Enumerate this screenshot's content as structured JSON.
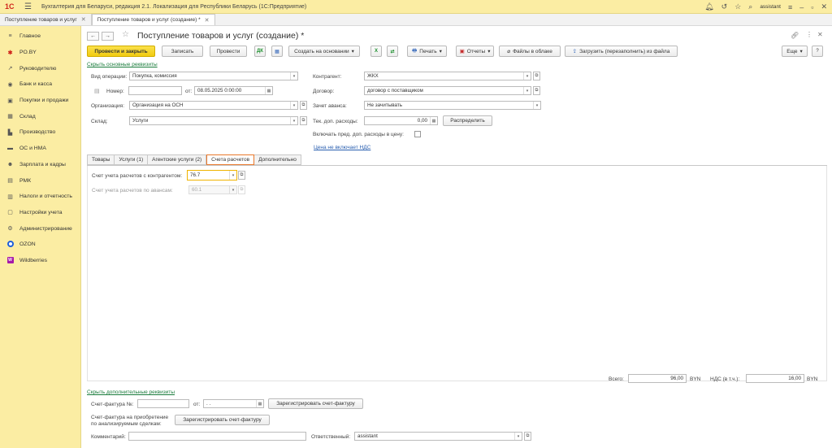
{
  "window": {
    "logo": "1С",
    "title": "Бухгалтерия для Беларуси, редакция 2.1. Локализация для Республики Беларусь   (1С:Предприятие)",
    "user": "assistant"
  },
  "open_tabs": [
    {
      "label": "Поступление товаров и услуг"
    },
    {
      "label": "Поступление товаров и услуг (создание) *"
    }
  ],
  "sidebar": {
    "items": [
      {
        "label": "Главное",
        "icon": "≡"
      },
      {
        "label": "PO.BY",
        "icon": "✱"
      },
      {
        "label": "Руководителю",
        "icon": "↗"
      },
      {
        "label": "Банк и касса",
        "icon": "◉"
      },
      {
        "label": "Покупки и продажи",
        "icon": "▣"
      },
      {
        "label": "Склад",
        "icon": "▦"
      },
      {
        "label": "Производство",
        "icon": "▙"
      },
      {
        "label": "ОС и НМА",
        "icon": "▬"
      },
      {
        "label": "Зарплата и кадры",
        "icon": "☻"
      },
      {
        "label": "РМК",
        "icon": "▤"
      },
      {
        "label": "Налоги и отчетность",
        "icon": "▥"
      },
      {
        "label": "Настройки учета",
        "icon": "▢"
      },
      {
        "label": "Администрирование",
        "icon": "⚙"
      },
      {
        "label": "OZON",
        "icon": "ozon"
      },
      {
        "label": "Wildberries",
        "icon": "W"
      }
    ]
  },
  "document": {
    "title": "Поступление товаров и услуг (создание) *"
  },
  "toolbar": {
    "post_close": "Провести и закрыть",
    "save": "Записать",
    "post": "Провести",
    "create_based": "Создать на основании",
    "print": "Печать",
    "reports": "Отчеты",
    "cloud_files": "Файлы в облаке",
    "load_file": "Загрузить (перезаполнить) из файла",
    "more": "Еще"
  },
  "links": {
    "hide_main": "Скрыть основные реквизиты",
    "price_no_vat": "Цена не включает НДС",
    "hide_extra": "Скрыть дополнительные реквизиты"
  },
  "form": {
    "operation_label": "Вид операции:",
    "operation_value": "Покупка, комиссия",
    "number_label": "Номер:",
    "number_value": "",
    "date_label": "от:",
    "date_value": "08.05.2025  0:00:00",
    "org_label": "Организация:",
    "org_value": "Организация на ОСН",
    "warehouse_label": "Склад:",
    "warehouse_value": "Услуги",
    "counterparty_label": "Контрагент:",
    "counterparty_value": "ЖКХ",
    "contract_label": "Договор:",
    "contract_value": "договор с поставщиком",
    "advance_label": "Зачет аванса:",
    "advance_value": "Не зачитывать",
    "extra_cost_label": "Тек. доп. расходы:",
    "extra_cost_value": "0,00",
    "distribute_btn": "Распределить",
    "include_label": "Включать пред. доп. расходы в цену:"
  },
  "tabs": [
    {
      "label": "Товары"
    },
    {
      "label": "Услуги (1)"
    },
    {
      "label": "Агентские услуги (2)"
    },
    {
      "label": "Счета расчетов"
    },
    {
      "label": "Дополнительно"
    }
  ],
  "accounts": {
    "counterparty_label": "Счет учета расчетов с контрагентом:",
    "counterparty_value": "76.7",
    "advance_label": "Счет учета расчетов по авансам:",
    "advance_value": "60.1"
  },
  "totals": {
    "total_label": "Всего:",
    "total_value": "96,00",
    "currency": "BYN",
    "vat_label": "НДС (в т.ч.):",
    "vat_value": "16,00"
  },
  "footer": {
    "invoice_label": "Счет-фактура №:",
    "invoice_value": "",
    "invoice_date_label": "от:",
    "invoice_date_value": " .  .",
    "register_btn": "Зарегистрировать счет-фактуру",
    "invoice2_label_1": "Счет-фактура на приобретение",
    "invoice2_label_2": "по анализируемым сделкам:",
    "register_btn2": "Зарегистрировать счет-фактуру",
    "comment_label": "Комментарий:",
    "comment_value": "",
    "responsible_label": "Ответственный:",
    "responsible_value": "assistant"
  }
}
